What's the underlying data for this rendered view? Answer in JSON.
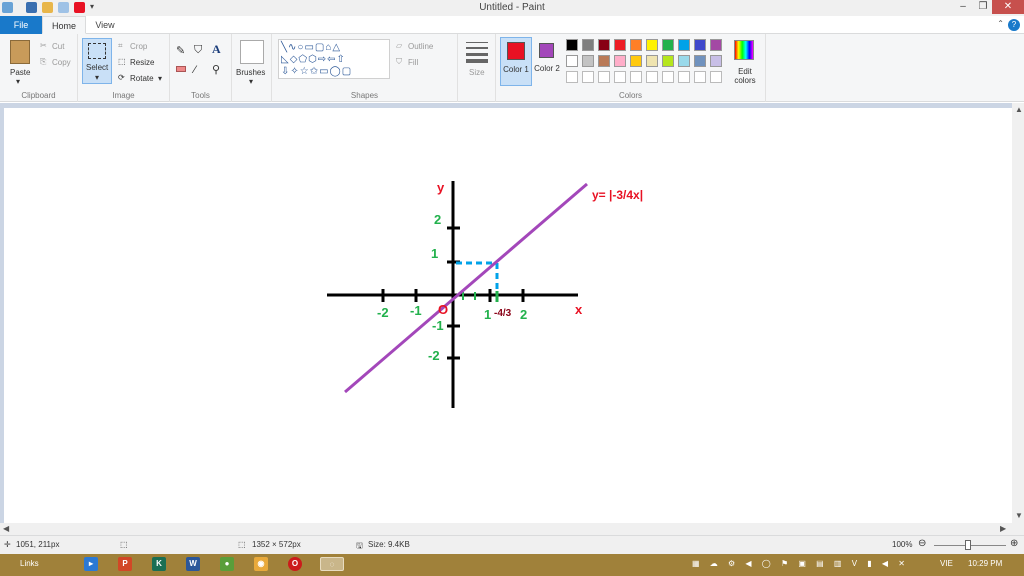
{
  "window": {
    "title": "Untitled - Paint"
  },
  "tabs": {
    "file": "File",
    "home": "Home",
    "view": "View"
  },
  "clipboard": {
    "paste": "Paste",
    "cut": "Cut",
    "copy": "Copy",
    "group": "Clipboard"
  },
  "image": {
    "select": "Select",
    "crop": "Crop",
    "resize": "Resize",
    "rotate": "Rotate",
    "group": "Image"
  },
  "tools": {
    "group": "Tools"
  },
  "brushes": {
    "label": "Brushes"
  },
  "shapes": {
    "outline": "Outline",
    "fill": "Fill",
    "group": "Shapes"
  },
  "size": {
    "label": "Size"
  },
  "colors": {
    "color1_label": "Color 1",
    "color2_label": "Color 2",
    "color1": "#e81123",
    "color2": "#a347ba",
    "edit": "Edit colors",
    "group": "Colors",
    "palette_row1": [
      "#000000",
      "#7f7f7f",
      "#880015",
      "#ed1c24",
      "#ff7f27",
      "#fff200",
      "#22b14c",
      "#00a2e8",
      "#3f48cc",
      "#a349a4"
    ],
    "palette_row2": [
      "#ffffff",
      "#c3c3c3",
      "#b97a57",
      "#ffaec9",
      "#ffc90e",
      "#efe4b0",
      "#b5e61d",
      "#99d9ea",
      "#7092be",
      "#c8bfe7"
    ]
  },
  "drawing": {
    "equation": "y= |-3/4x|",
    "x_axis": "x",
    "y_axis": "y",
    "origin": "O",
    "x_ticks": [
      "-2",
      "-1",
      "1",
      "-4/3",
      "2"
    ],
    "y_ticks": [
      "2",
      "1",
      "-1",
      "-2"
    ],
    "axis_color": "#000000",
    "line_color": "#a347ba",
    "label_color": "#22b14c",
    "accent_color": "#e81123",
    "guide_color": "#00a2e8"
  },
  "status": {
    "cursor_pos": "1051, 211px",
    "canvas_size": "1352 × 572px",
    "file_size": "Size: 9.4KB",
    "zoom": "100%"
  },
  "taskbar": {
    "links": "Links",
    "lang": "VIE",
    "time": "10:29 PM"
  }
}
